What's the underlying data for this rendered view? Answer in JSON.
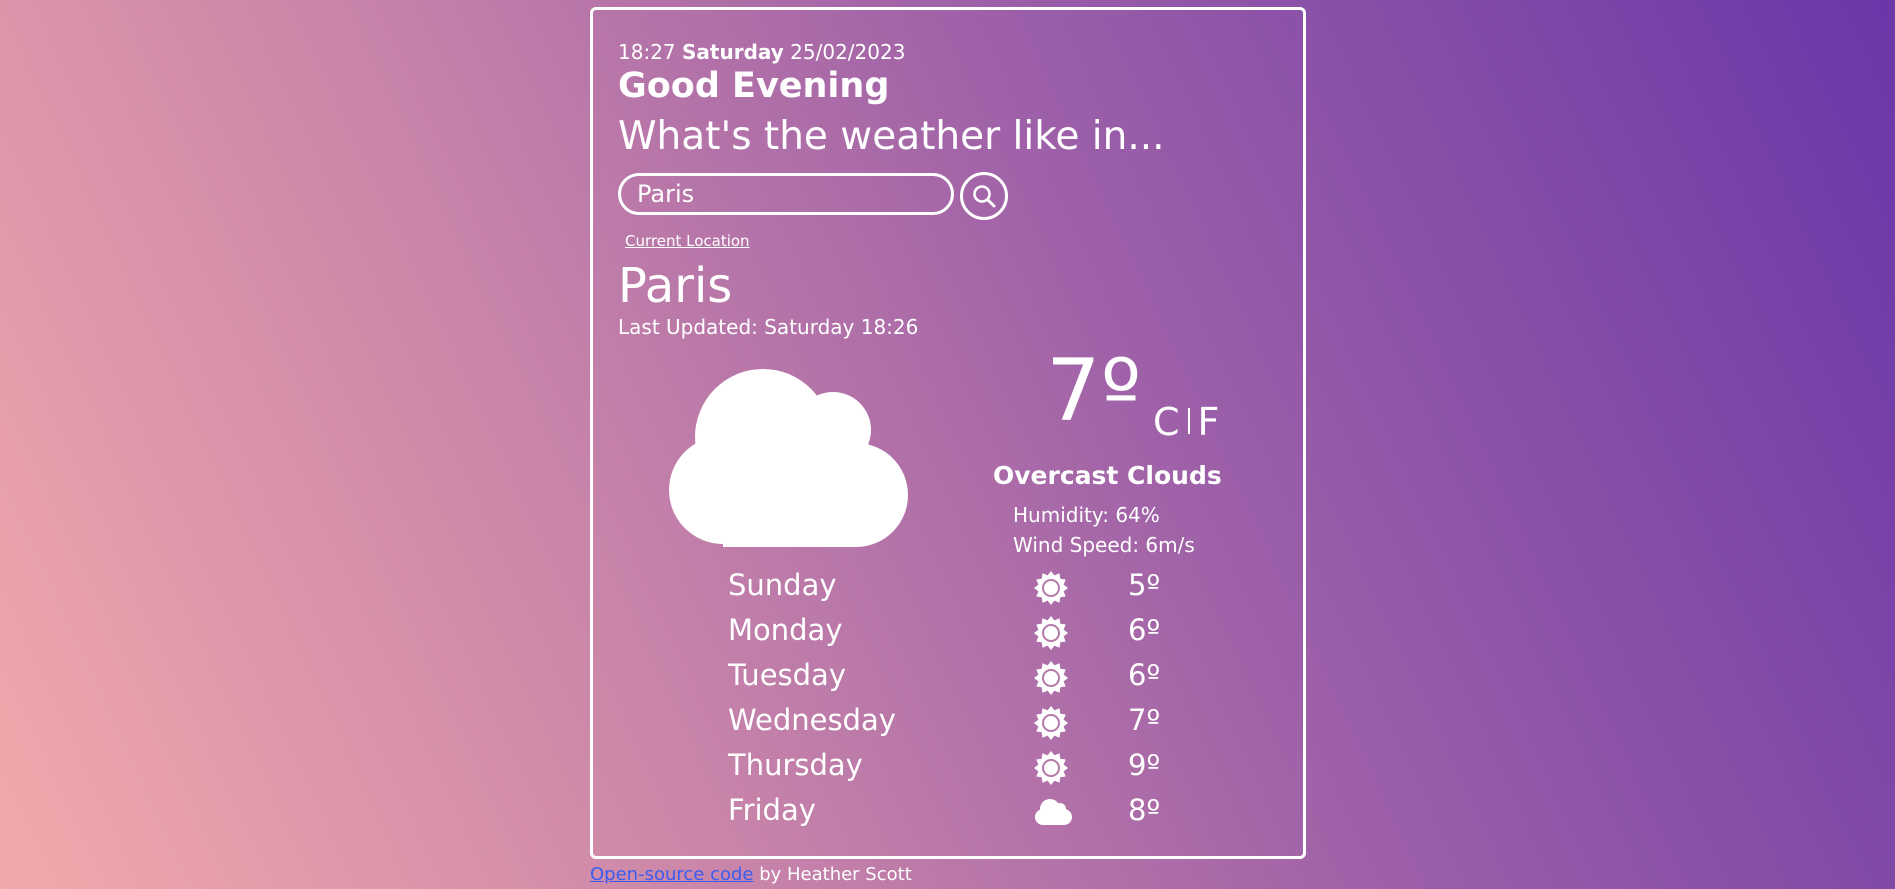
{
  "header": {
    "time": "18:27",
    "day": "Saturday",
    "date": "25/02/2023",
    "greeting": "Good Evening",
    "prompt": "What's the weather like in..."
  },
  "search": {
    "value": "Paris",
    "button_icon": "search-icon",
    "current_location_label": "Current Location"
  },
  "current": {
    "city": "Paris",
    "last_updated": "Last Updated: Saturday 18:26",
    "icon": "cloud-icon",
    "temperature": "7º",
    "unit_c": "C",
    "unit_f": "F",
    "description": "Overcast Clouds",
    "humidity": "Humidity: 64%",
    "wind": "Wind Speed: 6m/s"
  },
  "forecast": [
    {
      "day": "Sunday",
      "icon": "sun-icon",
      "temp": "5º"
    },
    {
      "day": "Monday",
      "icon": "sun-icon",
      "temp": "6º"
    },
    {
      "day": "Tuesday",
      "icon": "sun-icon",
      "temp": "6º"
    },
    {
      "day": "Wednesday",
      "icon": "sun-icon",
      "temp": "7º"
    },
    {
      "day": "Thursday",
      "icon": "sun-icon",
      "temp": "9º"
    },
    {
      "day": "Friday",
      "icon": "cloud-icon",
      "temp": "8º"
    }
  ],
  "footer": {
    "link_text": "Open-source code",
    "author_text": " by Heather Scott"
  },
  "colors": {
    "gradient_start": "#f3a9aa",
    "gradient_end": "#6a36a8",
    "text": "#ffffff",
    "link": "#3a5cf0"
  }
}
